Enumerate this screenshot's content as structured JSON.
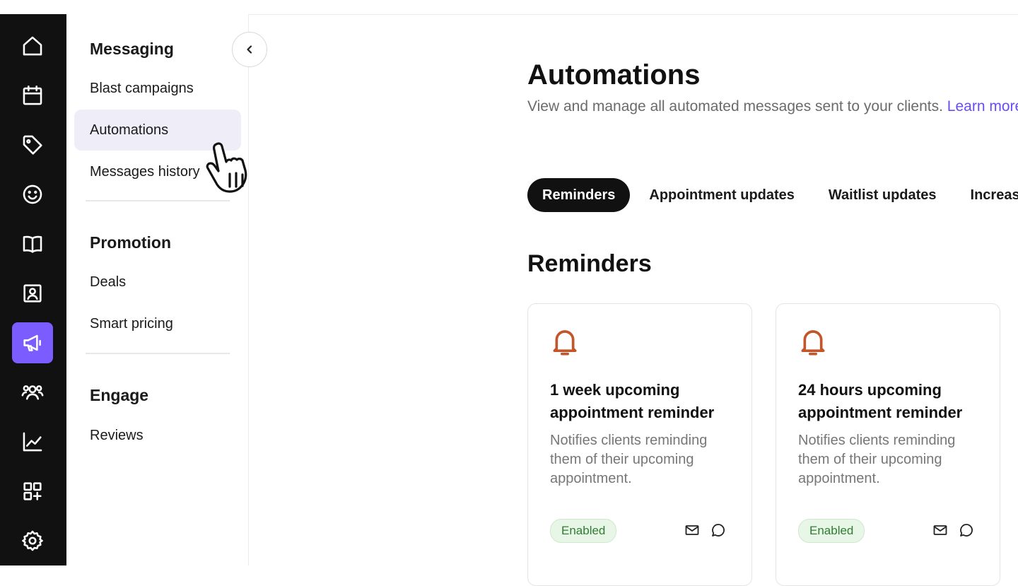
{
  "rail": {
    "items": [
      {
        "icon": "home-icon"
      },
      {
        "icon": "calendar-icon"
      },
      {
        "icon": "tag-icon"
      },
      {
        "icon": "smiley-icon"
      },
      {
        "icon": "book-icon"
      },
      {
        "icon": "contact-card-icon"
      },
      {
        "icon": "megaphone-icon",
        "active": true
      },
      {
        "icon": "team-icon"
      },
      {
        "icon": "chart-icon"
      },
      {
        "icon": "add-apps-icon"
      },
      {
        "icon": "gear-icon"
      }
    ],
    "active_color": "#7b5cff"
  },
  "subnav": {
    "groups": [
      {
        "title": "Messaging",
        "items": [
          "Blast campaigns",
          "Automations",
          "Messages history"
        ]
      },
      {
        "title": "Promotion",
        "items": [
          "Deals",
          "Smart pricing"
        ]
      },
      {
        "title": "Engage",
        "items": [
          "Reviews"
        ]
      }
    ],
    "active_item": "Automations"
  },
  "main": {
    "title": "Automations",
    "subtitle": "View and manage all automated messages sent to your clients.",
    "learn_more": "Learn more",
    "tabs": [
      "Reminders",
      "Appointment updates",
      "Waitlist updates",
      "Increase"
    ],
    "active_tab": "Reminders",
    "section_title": "Reminders",
    "cards": [
      {
        "title": "1 week upcoming appointment reminder",
        "description": "Notifies clients reminding them of their upcoming appointment.",
        "status": "Enabled"
      },
      {
        "title": "24 hours upcoming appointment reminder",
        "description": "Notifies clients reminding them of their upcoming appointment.",
        "status": "Enabled"
      }
    ]
  },
  "colors": {
    "accent": "#6a4cf5",
    "bell": "#c2562a",
    "enabled_text": "#2e7d32",
    "enabled_bg": "#e8f6e7"
  }
}
